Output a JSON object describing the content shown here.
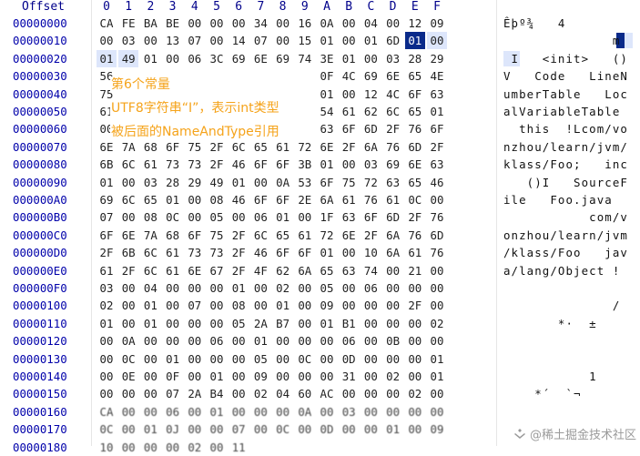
{
  "header": {
    "offset_label": "Offset",
    "columns": [
      "0",
      "1",
      "2",
      "3",
      "4",
      "5",
      "6",
      "7",
      "8",
      "9",
      "A",
      "B",
      "C",
      "D",
      "E",
      "F"
    ]
  },
  "rows": [
    {
      "offset": "00000000",
      "bytes": [
        "CA",
        "FE",
        "BA",
        "BE",
        "00",
        "00",
        "00",
        "34",
        "00",
        "16",
        "0A",
        "00",
        "04",
        "00",
        "12",
        "09"
      ],
      "ascii": "Êþº¾   4"
    },
    {
      "offset": "00000010",
      "bytes": [
        "00",
        "03",
        "00",
        "13",
        "07",
        "00",
        "14",
        "07",
        "00",
        "15",
        "01",
        "00",
        "01",
        "6D",
        "01",
        "00"
      ],
      "ascii": "              m  "
    },
    {
      "offset": "00000020",
      "bytes": [
        "01",
        "49",
        "01",
        "00",
        "06",
        "3C",
        "69",
        "6E",
        "69",
        "74",
        "3E",
        "01",
        "00",
        "03",
        "28",
        "29"
      ],
      "ascii": " I   <init>   ()"
    },
    {
      "offset": "00000030",
      "bytes": [
        "56",
        "",
        "",
        "",
        "",
        "",
        "",
        "",
        "",
        "",
        "0F",
        "4C",
        "69",
        "6E",
        "65",
        "4E"
      ],
      "ascii": "V   Code   LineN"
    },
    {
      "offset": "00000040",
      "bytes": [
        "75",
        "",
        "",
        "",
        "",
        "",
        "",
        "",
        "",
        "",
        "01",
        "00",
        "12",
        "4C",
        "6F",
        "63"
      ],
      "ascii": "umberTable   Loc"
    },
    {
      "offset": "00000050",
      "bytes": [
        "61",
        "",
        "",
        "",
        "",
        "",
        "",
        "",
        "",
        "",
        "54",
        "61",
        "62",
        "6C",
        "65",
        "01"
      ],
      "ascii": "alVariableTable "
    },
    {
      "offset": "00000060",
      "bytes": [
        "00",
        "",
        "",
        "",
        "",
        "",
        "",
        "",
        "",
        "",
        "63",
        "6F",
        "6D",
        "2F",
        "76",
        "6F"
      ],
      "ascii": "  this  !Lcom/vo"
    },
    {
      "offset": "00000070",
      "bytes": [
        "6E",
        "7A",
        "68",
        "6F",
        "75",
        "2F",
        "6C",
        "65",
        "61",
        "72",
        "6E",
        "2F",
        "6A",
        "76",
        "6D",
        "2F"
      ],
      "ascii": "nzhou/learn/jvm/"
    },
    {
      "offset": "00000080",
      "bytes": [
        "6B",
        "6C",
        "61",
        "73",
        "73",
        "2F",
        "46",
        "6F",
        "6F",
        "3B",
        "01",
        "00",
        "03",
        "69",
        "6E",
        "63"
      ],
      "ascii": "klass/Foo;   inc"
    },
    {
      "offset": "00000090",
      "bytes": [
        "01",
        "00",
        "03",
        "28",
        "29",
        "49",
        "01",
        "00",
        "0A",
        "53",
        "6F",
        "75",
        "72",
        "63",
        "65",
        "46"
      ],
      "ascii": "   ()I   SourceF"
    },
    {
      "offset": "000000A0",
      "bytes": [
        "69",
        "6C",
        "65",
        "01",
        "00",
        "08",
        "46",
        "6F",
        "6F",
        "2E",
        "6A",
        "61",
        "76",
        "61",
        "0C",
        "00"
      ],
      "ascii": "ile   Foo.java  "
    },
    {
      "offset": "000000B0",
      "bytes": [
        "07",
        "00",
        "08",
        "0C",
        "00",
        "05",
        "00",
        "06",
        "01",
        "00",
        "1F",
        "63",
        "6F",
        "6D",
        "2F",
        "76"
      ],
      "ascii": "           com/v"
    },
    {
      "offset": "000000C0",
      "bytes": [
        "6F",
        "6E",
        "7A",
        "68",
        "6F",
        "75",
        "2F",
        "6C",
        "65",
        "61",
        "72",
        "6E",
        "2F",
        "6A",
        "76",
        "6D"
      ],
      "ascii": "onzhou/learn/jvm"
    },
    {
      "offset": "000000D0",
      "bytes": [
        "2F",
        "6B",
        "6C",
        "61",
        "73",
        "73",
        "2F",
        "46",
        "6F",
        "6F",
        "01",
        "00",
        "10",
        "6A",
        "61",
        "76"
      ],
      "ascii": "/klass/Foo   jav"
    },
    {
      "offset": "000000E0",
      "bytes": [
        "61",
        "2F",
        "6C",
        "61",
        "6E",
        "67",
        "2F",
        "4F",
        "62",
        "6A",
        "65",
        "63",
        "74",
        "00",
        "21",
        "00"
      ],
      "ascii": "a/lang/Object !"
    },
    {
      "offset": "000000F0",
      "bytes": [
        "03",
        "00",
        "04",
        "00",
        "00",
        "00",
        "01",
        "00",
        "02",
        "00",
        "05",
        "00",
        "06",
        "00",
        "00",
        "00"
      ],
      "ascii": ""
    },
    {
      "offset": "00000100",
      "bytes": [
        "02",
        "00",
        "01",
        "00",
        "07",
        "00",
        "08",
        "00",
        "01",
        "00",
        "09",
        "00",
        "00",
        "00",
        "2F",
        "00"
      ],
      "ascii": "              /"
    },
    {
      "offset": "00000110",
      "bytes": [
        "01",
        "00",
        "01",
        "00",
        "00",
        "00",
        "05",
        "2A",
        "B7",
        "00",
        "01",
        "B1",
        "00",
        "00",
        "00",
        "02"
      ],
      "ascii": "       *·  ±"
    },
    {
      "offset": "00000120",
      "bytes": [
        "00",
        "0A",
        "00",
        "00",
        "00",
        "06",
        "00",
        "01",
        "00",
        "00",
        "00",
        "06",
        "00",
        "0B",
        "00",
        "00"
      ],
      "ascii": ""
    },
    {
      "offset": "00000130",
      "bytes": [
        "00",
        "0C",
        "00",
        "01",
        "00",
        "00",
        "00",
        "05",
        "00",
        "0C",
        "00",
        "0D",
        "00",
        "00",
        "00",
        "01"
      ],
      "ascii": ""
    },
    {
      "offset": "00000140",
      "bytes": [
        "00",
        "0E",
        "00",
        "0F",
        "00",
        "01",
        "00",
        "09",
        "00",
        "00",
        "00",
        "31",
        "00",
        "02",
        "00",
        "01"
      ],
      "ascii": "           1"
    },
    {
      "offset": "00000150",
      "bytes": [
        "00",
        "00",
        "00",
        "07",
        "2A",
        "B4",
        "00",
        "02",
        "04",
        "60",
        "AC",
        "00",
        "00",
        "00",
        "02",
        "00"
      ],
      "ascii": "    *´  `¬"
    },
    {
      "offset": "00000160",
      "bytes": [
        "CA",
        "00",
        "00",
        "06",
        "00",
        "01",
        "00",
        "00",
        "00",
        "0A",
        "00",
        "03",
        "00",
        "00",
        "00",
        "00"
      ],
      "ascii": ""
    },
    {
      "offset": "00000170",
      "bytes": [
        "0C",
        "00",
        "01",
        "0J",
        "00",
        "00",
        "07",
        "00",
        "0C",
        "00",
        "0D",
        "00",
        "00",
        "01",
        "00",
        "09"
      ],
      "ascii": ""
    },
    {
      "offset": "00000180",
      "bytes": [
        "10",
        "00",
        "00",
        "00",
        "02",
        "00",
        "11",
        "",
        "",
        "",
        "",
        "",
        "",
        "",
        "",
        ""
      ],
      "ascii": ""
    }
  ],
  "annotations": [
    {
      "text": "第6个常量"
    },
    {
      "text": "UTF8字符串“I”，表示int类型"
    },
    {
      "text": "被后面的NameAndType引用"
    }
  ],
  "watermark": {
    "text": "@稀土掘金技术社区"
  },
  "colors": {
    "annotation": "#f5a31a",
    "offset_text": "#0000aa",
    "cursor_bg": "#0a2a8a",
    "selection_bg": "#dde6fb"
  }
}
